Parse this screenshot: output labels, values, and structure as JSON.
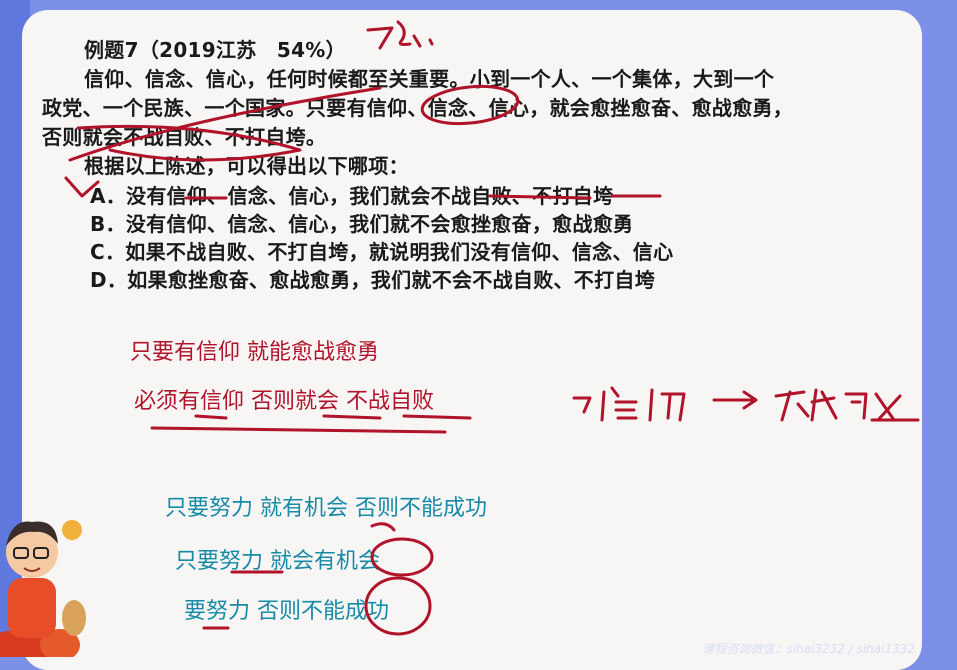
{
  "question": {
    "header": "例题7（2019江苏　54%）",
    "stem_line1": "信仰、信念、信心，任何时候都至关重要。小到一个人、一个集体，大到一个",
    "stem_line2": "政党、一个民族、一个国家。只要有信仰、信念、信心，就会愈挫愈奋、愈战愈勇，",
    "stem_line3": "否则就会不战自败、不打自垮。",
    "prompt": "根据以上陈述，可以得出以下哪项：",
    "options": [
      "A．没有信仰、信念、信心，我们就会不战自败、不打自垮",
      "B．没有信仰、信念、信心，我们就不会愈挫愈奋，愈战愈勇",
      "C．如果不战自败、不打自垮，就说明我们没有信仰、信念、信心",
      "D．如果愈挫愈奋、愈战愈勇，我们就不会不战自败、不打自垮"
    ]
  },
  "notes_red": {
    "line1": "只要有信仰 就能愈战愈勇",
    "line2": "必须有信仰 否则就会  不战自败"
  },
  "notes_teal": {
    "line1": "只要努力 就有机会 否则不能成功",
    "line2": "只要努力 就会有机会",
    "line3": "要努力 否则不能成功"
  },
  "footer_text": "课程咨询微信：sihai3232 / sihai1332",
  "colors": {
    "background": "#7b90e6",
    "slide": "#f7f6f4",
    "ink_red": "#b0132a",
    "teal": "#168aa6"
  }
}
